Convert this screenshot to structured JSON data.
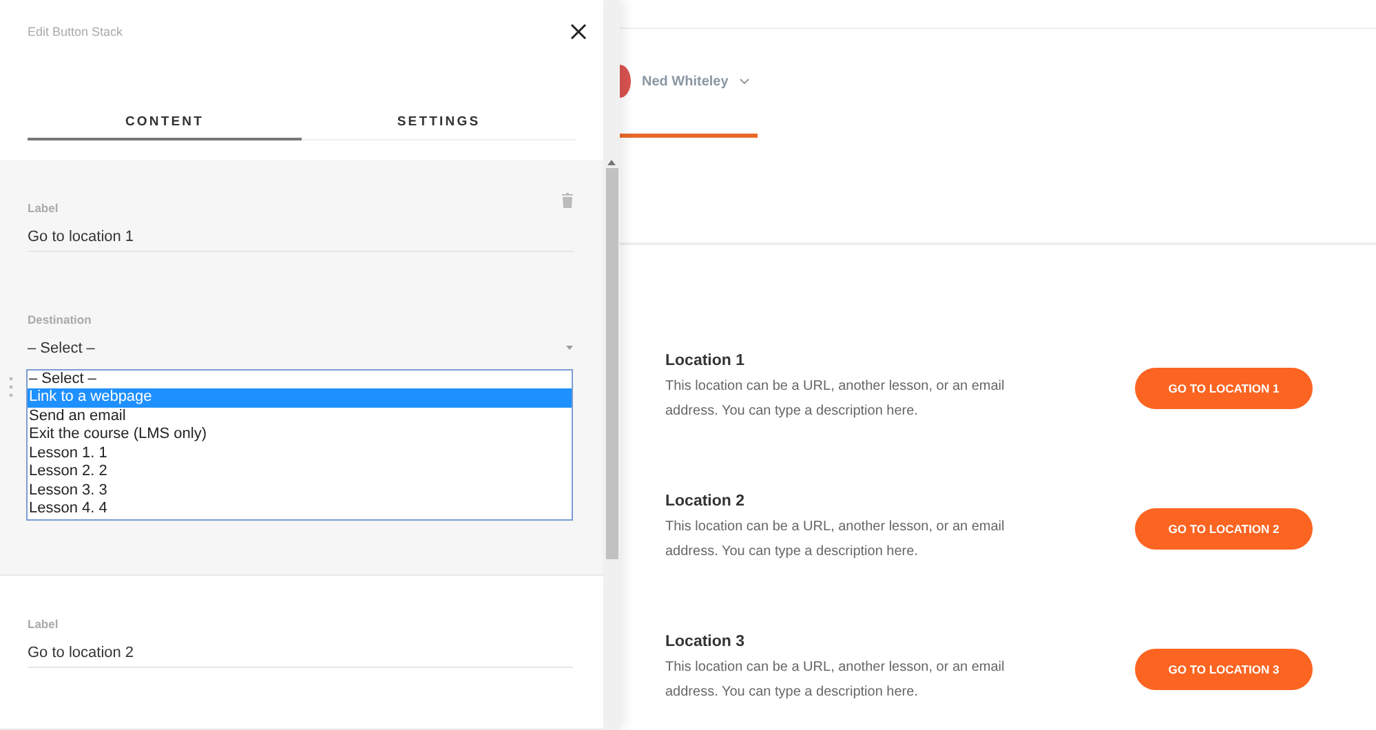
{
  "panel": {
    "title": "Edit Button Stack",
    "tabs": [
      {
        "label": "CONTENT",
        "selected": true
      },
      {
        "label": "SETTINGS",
        "selected": false
      }
    ],
    "items": [
      {
        "selected": true,
        "label_caption": "Label",
        "label_value": "Go to location 1",
        "destination_caption": "Destination",
        "destination_value": "– Select –",
        "expanded": true,
        "options": [
          {
            "label": "– Select –",
            "selected": false
          },
          {
            "label": "Link to a webpage",
            "selected": true
          },
          {
            "label": "Send an email",
            "selected": false
          },
          {
            "label": "Exit the course (LMS only)",
            "selected": false
          },
          {
            "label": "Lesson 1. 1",
            "selected": false
          },
          {
            "label": "Lesson 2. 2",
            "selected": false
          },
          {
            "label": "Lesson 3. 3",
            "selected": false
          },
          {
            "label": "Lesson 4. 4",
            "selected": false
          }
        ]
      },
      {
        "selected": false,
        "label_caption": "Label",
        "label_value": "Go to location 2"
      }
    ]
  },
  "header": {
    "user": "Ned Whiteley"
  },
  "locations": [
    {
      "title": "Location 1",
      "description": "This location can be a URL, another lesson, or an email address. You can type a description here.",
      "button": "GO TO LOCATION 1"
    },
    {
      "title": "Location 2",
      "description": "This location can be a URL, another lesson, or an email address. You can type a description here.",
      "button": "GO TO LOCATION 2"
    },
    {
      "title": "Location 3",
      "description": "This location can be a URL, another lesson, or an email address. You can type a description here.",
      "button": "GO TO LOCATION 3"
    }
  ]
}
